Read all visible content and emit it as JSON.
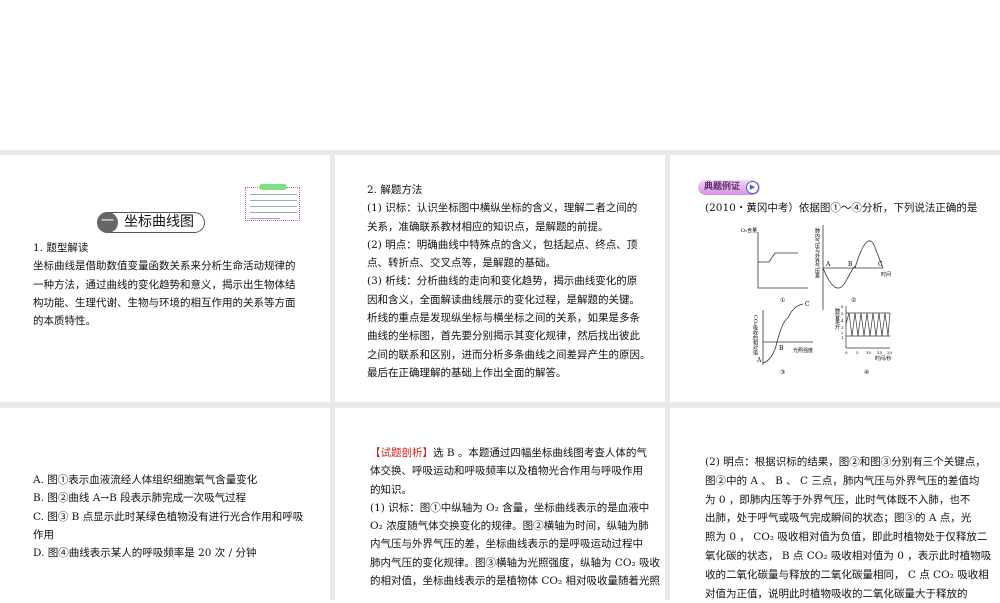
{
  "slides": [
    {
      "badge_num": "一",
      "badge_title": "坐标曲线图",
      "lines": [
        "1. 题型解读",
        "坐标曲线是借助数值变量函数关系来分析生命活动规律的",
        "一种方法，通过曲线的变化趋势和意义，揭示出生物体结",
        "构功能、生理代谢、生物与环境的相互作用的关系等方面",
        "的本质特性。"
      ]
    },
    {
      "lines": [
        "2. 解题方法",
        "(1) 识标：认识坐标图中横纵坐标的含义，理解二者之间的",
        "关系，准确联系教材相应的知识点，是解题的前提。",
        "(2) 明点：明确曲线中特殊点的含义，包括起点、终点、顶",
        "点、转折点、交叉点等，是解题的基础。",
        "(3) 析线：分析曲线的走向和变化趋势，揭示曲线变化的原",
        "因和含义，全面解读曲线展示的变化过程，是解题的关键。",
        "析线的重点是发现纵坐标与横坐标之间的关系，如果是多条",
        "曲线的坐标图，首先要分别揭示其变化规律，然后找出彼此",
        "之间的联系和区别，进而分析多条曲线之间差异产生的原因。",
        "最后在正确理解的基础上作出全面的解答。"
      ]
    },
    {
      "badge": "典题例证",
      "question": "(2010・黄冈中考）依据图①～④分析，下列说法正确的是",
      "fig1": {
        "ylabel": "O₂含量",
        "caption": "①"
      },
      "fig2": {
        "ylabel": "肺内气压与外界气压差",
        "xlabel": "时间",
        "points": [
          "A",
          "B",
          "C"
        ],
        "caption": "②"
      },
      "fig3": {
        "ylabel": "CO₂吸收的相对值",
        "xlabel": "光照强度",
        "points": [
          "A",
          "B",
          "C"
        ],
        "caption": "③"
      },
      "fig4": {
        "ylabel": "肺容量/升",
        "xlabel": "时间/秒",
        "yticks": [
          "6",
          "5",
          "4",
          "3",
          "2",
          "1"
        ],
        "xticks": [
          "0",
          "5",
          "10",
          "15",
          "20"
        ],
        "caption": "④"
      }
    },
    {
      "lines": [
        "A. 图①表示血液流经人体组织细胞氧气含量变化",
        "B. 图②曲线 A→B 段表示肺完成一次吸气过程",
        "C. 图③ B 点显示此时某绿色植物没有进行光合作用和呼吸",
        "作用",
        "D. 图④曲线表示某人的呼吸频率是 20 次 / 分钟"
      ]
    },
    {
      "tag": "【试题剖析】",
      "first": "选 B 。本题通过四幅坐标曲线图考查人体的气",
      "lines": [
        "体交换、呼吸运动和呼吸频率以及植物光合作用与呼吸作用",
        "的知识。",
        "(1) 识标：图①中纵轴为 O₂ 含量，坐标曲线表示的是血液中",
        "O₂ 浓度随气体交换变化的规律。图②横轴为时间，纵轴为肺",
        "内气压与外界气压的差，坐标曲线表示的是呼吸运动过程中",
        "肺内气压的变化规律。图③横轴为光照强度，纵轴为 CO₂ 吸收",
        "的相对值，坐标曲线表示的是植物体 CO₂ 相对吸收量随着光照"
      ]
    },
    {
      "lines": [
        "(2) 明点：根据识标的结果，图②和图③分别有三个关键点，",
        "图②中的 A 、 B 、 C 三点，肺内气压与外界气压的差值均",
        "为 0 ，即肺内压等于外界气压，此时气体既不入肺，也不",
        "出肺，处于呼气或吸气完成瞬间的状态；图③的 A 点，光",
        "照为 0 ， CO₂ 吸收相对值为负值，即此时植物处于仅释放二",
        "氧化碳的状态， B 点 CO₂ 吸收相对值为 0 ，表示此时植物吸",
        "收的二氧化碳量与释放的二氧化碳量相同， C 点 CO₂ 吸收相",
        "对值为正值，说明此时植物吸收的二氧化碳量大于释放的"
      ]
    }
  ]
}
